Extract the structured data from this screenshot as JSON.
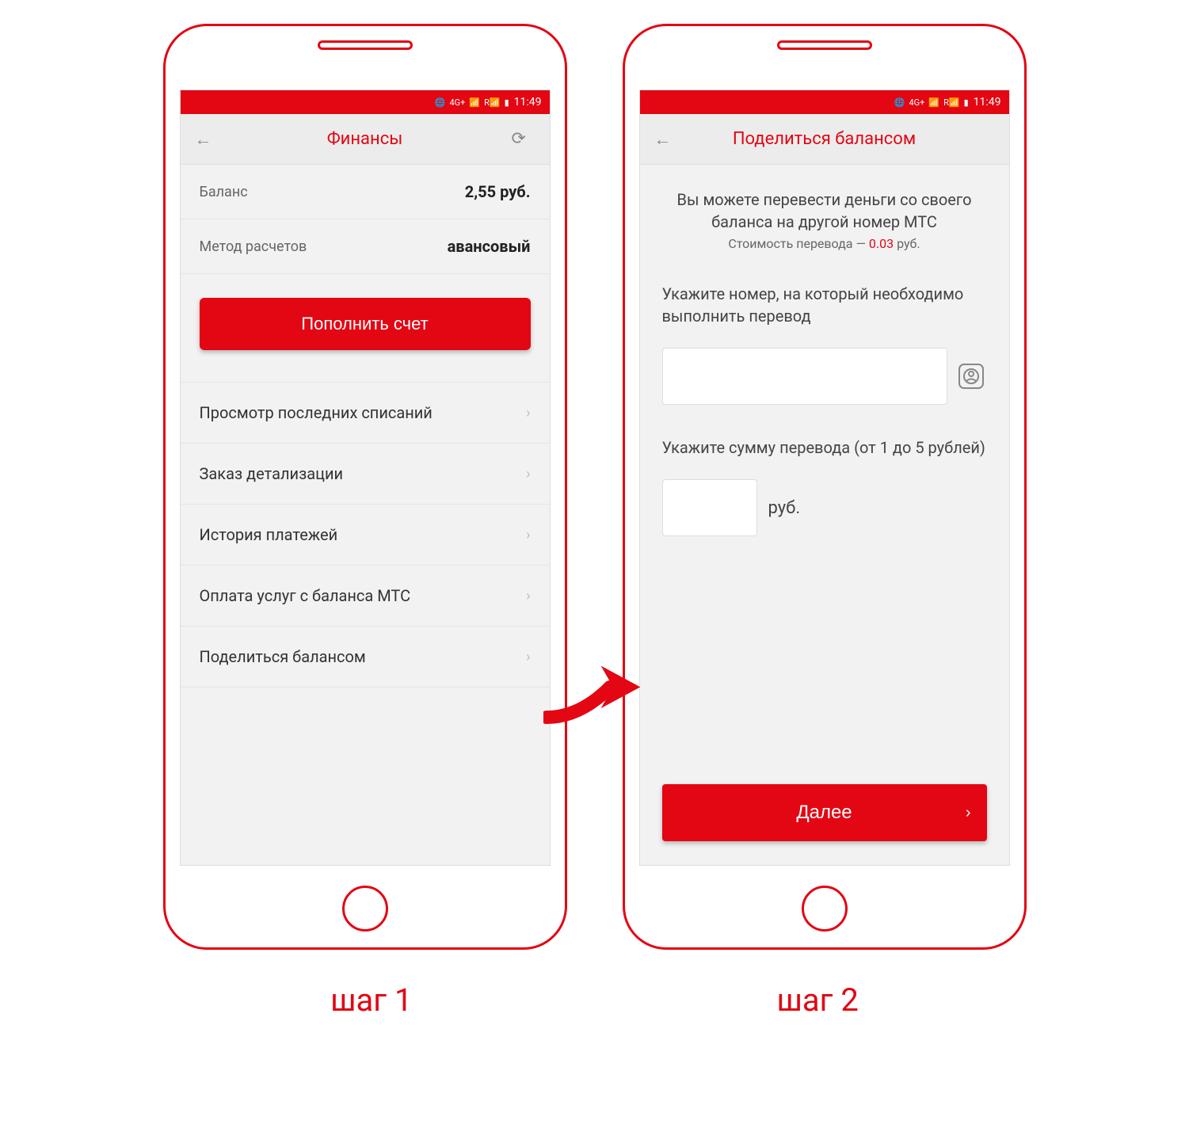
{
  "status": {
    "time": "11:49"
  },
  "screen1": {
    "title": "Финансы",
    "balance_label": "Баланс",
    "balance_value": "2,55 руб.",
    "method_label": "Метод расчетов",
    "method_value": "авансовый",
    "topup_button": "Пополнить счет",
    "menu": [
      "Просмотр последних списаний",
      "Заказ детализации",
      "История платежей",
      "Оплата услуг с баланса МТС",
      "Поделиться балансом"
    ]
  },
  "screen2": {
    "title": "Поделиться балансом",
    "description": "Вы можете перевести деньги со своего баланса на другой номер МТС",
    "cost_prefix": "Стоимость перевода — ",
    "cost_value": "0.03",
    "cost_suffix": " руб.",
    "phone_label": "Укажите номер, на который необходимо выполнить перевод",
    "amount_label": "Укажите сумму перевода (от 1 до 5 рублей)",
    "amount_unit": "руб.",
    "next_button": "Далее"
  },
  "steps": {
    "step1": "шаг 1",
    "step2": "шаг 2"
  }
}
